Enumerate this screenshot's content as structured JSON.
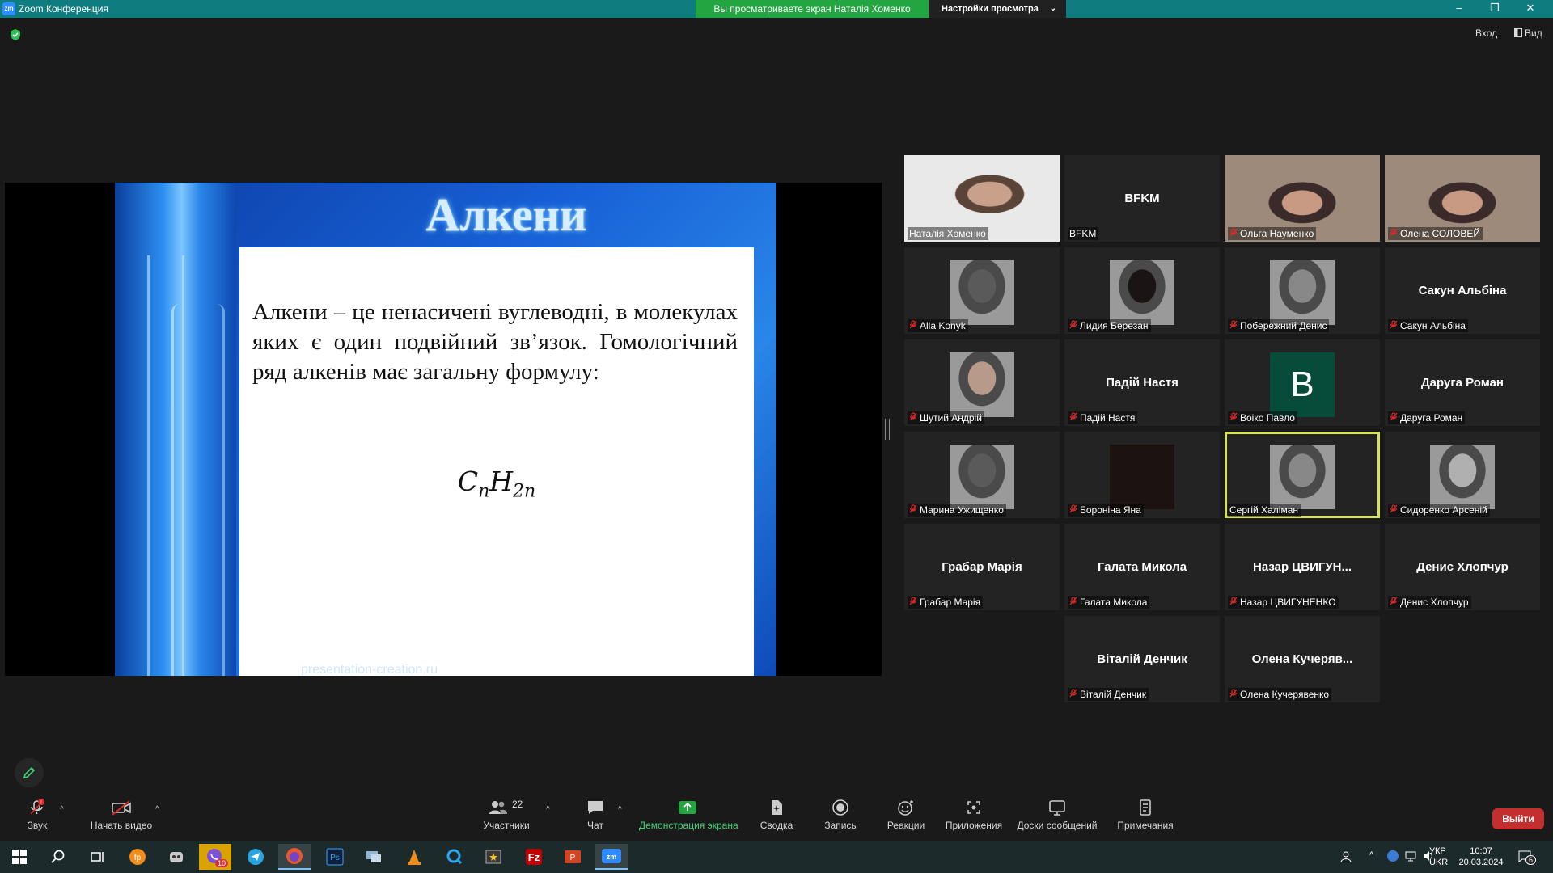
{
  "window": {
    "app_icon_text": "zm",
    "title": "Zoom Конференция",
    "share_banner": "Вы просматриваете экран Наталія Хоменко",
    "view_options": "Настройки просмотра",
    "controls": {
      "minimize": "–",
      "restore": "❐",
      "close": "✕"
    }
  },
  "top_bar": {
    "enter_label": "Вход",
    "view_label": "Вид"
  },
  "slide": {
    "title": "Алкени",
    "body": "Алкени – це ненасичені вуглеводні, в молекулах яких є один подвійний зв’язок. Гомологічний ряд алкенів має загальну формулу:",
    "formula": {
      "c": "C",
      "c_sub": "n",
      "h": "H",
      "h_sub": "2n"
    },
    "footer": "presentation-creation.ru"
  },
  "participants": [
    {
      "name": "Наталія Хоменко",
      "muted": false,
      "video": "photo"
    },
    {
      "name": "BFKM",
      "display": "BFKM",
      "muted": false,
      "video": "none"
    },
    {
      "name": "Ольга Науменко",
      "muted": true,
      "video": "photo"
    },
    {
      "name": "Олена СОЛОВЕЙ",
      "muted": true,
      "video": "photo"
    },
    {
      "name": "Alla Konyk",
      "muted": true,
      "video": "thumb"
    },
    {
      "name": "Лидия Березан",
      "muted": true,
      "video": "thumb"
    },
    {
      "name": "Побережний Денис",
      "muted": true,
      "video": "thumb"
    },
    {
      "name": "Сакун Альбіна",
      "display": "Сакун Альбіна",
      "muted": true,
      "video": "none"
    },
    {
      "name": "Шутий Андрій",
      "muted": true,
      "video": "thumb"
    },
    {
      "name": "Падій Настя",
      "display": "Падій Настя",
      "muted": true,
      "video": "none"
    },
    {
      "name": "Воіко Павло",
      "avatar_letter": "B",
      "muted": true,
      "video": "letter"
    },
    {
      "name": "Даруга Роман",
      "display": "Даруга Роман",
      "muted": true,
      "video": "none"
    },
    {
      "name": "Марина Ужищенко",
      "muted": true,
      "video": "thumb"
    },
    {
      "name": "Бороніна Яна",
      "muted": true,
      "video": "dark"
    },
    {
      "name": "Сергій Халіман",
      "muted": false,
      "video": "thumb",
      "active_speaker": true
    },
    {
      "name": "Сидоренко Арсеній",
      "muted": true,
      "video": "thumb"
    },
    {
      "name": "Грабар Марія",
      "display": "Грабар Марія",
      "muted": true,
      "video": "none"
    },
    {
      "name": "Галата Микола",
      "display": "Галата Микола",
      "muted": true,
      "video": "none"
    },
    {
      "name": "Назар ЦВИГУНЕНКО",
      "display": "Назар  ЦВИГУН...",
      "muted": true,
      "video": "none"
    },
    {
      "name": "Денис Хлопчур",
      "display": "Денис Хлопчур",
      "muted": true,
      "video": "none"
    },
    {
      "name": "Віталій Денчик",
      "display": "Віталій Денчик",
      "muted": true,
      "video": "none"
    },
    {
      "name": "Олена Кучерявенко",
      "display": "Олена  Кучеряв...",
      "muted": true,
      "video": "none"
    }
  ],
  "toolbar": {
    "audio": "Звук",
    "audio_badge": "!",
    "video": "Начать видео",
    "participants": "Участники",
    "participants_count": "22",
    "chat": "Чат",
    "share": "Демонстрация экрана",
    "summary": "Сводка",
    "record": "Запись",
    "reactions": "Реакции",
    "apps": "Приложения",
    "whiteboards": "Доски сообщений",
    "notes": "Примечания",
    "leave": "Выйти"
  },
  "taskbar": {
    "lang_top": "УКР",
    "lang_bottom": "UKR",
    "time": "10:07",
    "date": "20.03.2024",
    "viber_badge": "10",
    "notif_badge": "6"
  },
  "colors": {
    "titlebar": "#0f7c80",
    "share_banner": "#23a542",
    "active_speaker": "#d6e25b",
    "leave": "#c32e2e",
    "share_label": "#3ed47a",
    "muted_mic": "#e02828"
  }
}
